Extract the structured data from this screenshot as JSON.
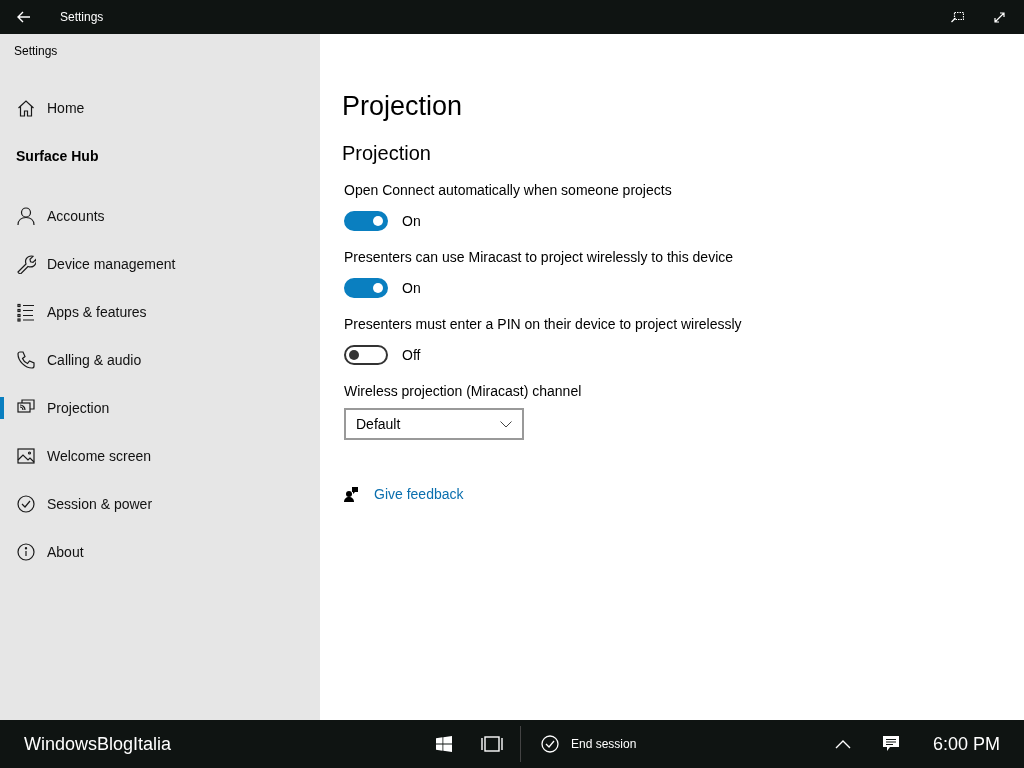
{
  "window": {
    "title": "Settings"
  },
  "sidebar": {
    "title": "Settings",
    "home": {
      "label": "Home",
      "selected": false
    },
    "section": "Surface Hub",
    "items": [
      {
        "label": "Accounts",
        "selected": false
      },
      {
        "label": "Device management",
        "selected": false
      },
      {
        "label": "Apps & features",
        "selected": false
      },
      {
        "label": "Calling & audio",
        "selected": false
      },
      {
        "label": "Projection",
        "selected": true
      },
      {
        "label": "Welcome screen",
        "selected": false
      },
      {
        "label": "Session & power",
        "selected": false
      },
      {
        "label": "About",
        "selected": false
      }
    ]
  },
  "main": {
    "heading": "Projection",
    "subheading": "Projection",
    "settings": [
      {
        "kind": "toggle",
        "label": "Open Connect automatically when someone projects",
        "on": true,
        "state_text": "On"
      },
      {
        "kind": "toggle",
        "label": "Presenters can use Miracast to project wirelessly to this device",
        "on": true,
        "state_text": "On"
      },
      {
        "kind": "toggle",
        "label": "Presenters must enter a PIN on their device to project wirelessly",
        "on": false,
        "state_text": "Off"
      },
      {
        "kind": "dropdown",
        "label": "Wireless projection (Miracast) channel",
        "value": "Default"
      }
    ],
    "feedback_link": "Give feedback"
  },
  "taskbar": {
    "device_name": "WindowsBlogItalia",
    "end_session": "End session",
    "time": "6:00 PM"
  }
}
